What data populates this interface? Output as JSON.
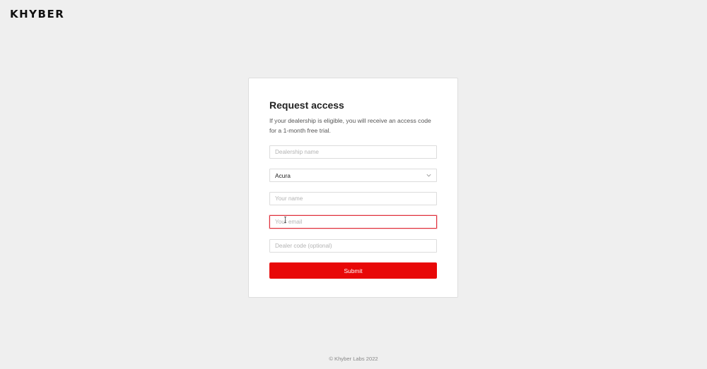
{
  "brand": {
    "logo_text": "KHYBER"
  },
  "form": {
    "title": "Request access",
    "description": "If your dealership is eligible, you will receive an access code for a 1-month free trial.",
    "dealership_name": {
      "placeholder": "Dealership name",
      "value": ""
    },
    "make_select": {
      "selected": "Acura"
    },
    "your_name": {
      "placeholder": "Your name",
      "value": ""
    },
    "your_email": {
      "placeholder": "Your email",
      "value": ""
    },
    "dealer_code": {
      "placeholder": "Dealer code (optional)",
      "value": ""
    },
    "submit_label": "Submit"
  },
  "footer": {
    "copyright": "© Khyber Labs 2022"
  },
  "colors": {
    "background": "#efefef",
    "submit": "#e80808",
    "focus_border": "#e0303c"
  }
}
